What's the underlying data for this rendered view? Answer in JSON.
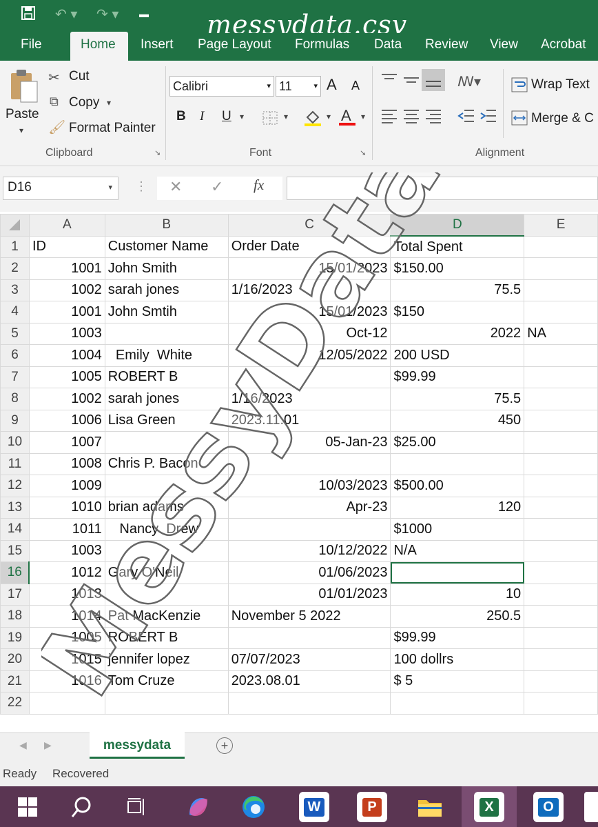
{
  "window": {
    "title": "messydata.csv"
  },
  "tabs": [
    "File",
    "Home",
    "Insert",
    "Page Layout",
    "Formulas",
    "Data",
    "Review",
    "View",
    "Acrobat"
  ],
  "ribbon": {
    "clipboard": {
      "paste": "Paste",
      "cut": "Cut",
      "copy": "Copy",
      "format_painter": "Format Painter",
      "label": "Clipboard"
    },
    "font": {
      "family": "Calibri",
      "size": "11",
      "label": "Font",
      "bold": "B",
      "italic": "I",
      "underline": "U",
      "grow": "A",
      "shrink": "A"
    },
    "alignment": {
      "wrap_text": "Wrap Text",
      "merge": "Merge & C",
      "label": "Alignment"
    }
  },
  "formula_bar": {
    "name_box": "D16",
    "fx": "fx",
    "value": ""
  },
  "grid": {
    "columns": [
      "A",
      "B",
      "C",
      "D",
      "E"
    ],
    "active_cell": "D16",
    "rows": [
      {
        "n": "1",
        "a": "ID",
        "b": "Customer Name",
        "c": "Order Date",
        "d": "Total Spent",
        "e": ""
      },
      {
        "n": "2",
        "a": "1001",
        "b": "John Smith",
        "c": "15/01/2023",
        "d": "$150.00",
        "e": ""
      },
      {
        "n": "3",
        "a": "1002",
        "b": "sarah jones",
        "c": "1/16/2023",
        "d": "75.5",
        "e": ""
      },
      {
        "n": "4",
        "a": "1001",
        "b": "John Smtih",
        "c": "15/01/2023",
        "d": "$150",
        "e": ""
      },
      {
        "n": "5",
        "a": "1003",
        "b": "",
        "c": "Oct-12",
        "d": "2022",
        "e": "NA"
      },
      {
        "n": "6",
        "a": "1004",
        "b": "  Emily  White",
        "c": "12/05/2022",
        "d": "200 USD",
        "e": ""
      },
      {
        "n": "7",
        "a": "1005",
        "b": "ROBERT B",
        "c": "",
        "d": "$99.99",
        "e": ""
      },
      {
        "n": "8",
        "a": "1002",
        "b": "sarah jones",
        "c": "1/16/2023",
        "d": "75.5",
        "e": ""
      },
      {
        "n": "9",
        "a": "1006",
        "b": "Lisa Green",
        "c": "2023.11.01",
        "d": "450",
        "e": ""
      },
      {
        "n": "10",
        "a": "1007",
        "b": "",
        "c": "05-Jan-23",
        "d": "$25.00",
        "e": ""
      },
      {
        "n": "11",
        "a": "1008",
        "b": "Chris P. Bacon",
        "c": "",
        "d": "",
        "e": ""
      },
      {
        "n": "12",
        "a": "1009",
        "b": "",
        "c": "10/03/2023",
        "d": "$500.00",
        "e": ""
      },
      {
        "n": "13",
        "a": "1010",
        "b": "brian adams",
        "c": "Apr-23",
        "d": "120",
        "e": ""
      },
      {
        "n": "14",
        "a": "1011",
        "b": "   Nancy  Drew",
        "c": "",
        "d": "$1000",
        "e": ""
      },
      {
        "n": "15",
        "a": "1003",
        "b": "",
        "c": "10/12/2022",
        "d": "N/A",
        "e": ""
      },
      {
        "n": "16",
        "a": "1012",
        "b": "Gary O'Neil",
        "c": "01/06/2023",
        "d": "",
        "e": ""
      },
      {
        "n": "17",
        "a": "1013",
        "b": "",
        "c": "01/01/2023",
        "d": "10",
        "e": ""
      },
      {
        "n": "18",
        "a": "1014",
        "b": "Pat MacKenzie",
        "c": "November 5 2022",
        "d": "250.5",
        "e": ""
      },
      {
        "n": "19",
        "a": "1005",
        "b": "ROBERT B",
        "c": "",
        "d": "$99.99",
        "e": ""
      },
      {
        "n": "20",
        "a": "1015",
        "b": "jennifer lopez",
        "c": "07/07/2023",
        "d": "100 dollrs",
        "e": ""
      },
      {
        "n": "21",
        "a": "1016",
        "b": "Tom Cruze",
        "c": "2023.08.01",
        "d": "$ 5",
        "e": ""
      },
      {
        "n": "22",
        "a": "",
        "b": "",
        "c": "",
        "d": "",
        "e": ""
      }
    ],
    "align": {
      "c_right_rows": [
        "2",
        "4",
        "5",
        "6",
        "10",
        "12",
        "13",
        "15",
        "16",
        "17"
      ],
      "d_right_rows": [
        "3",
        "5",
        "8",
        "9",
        "13",
        "17",
        "18"
      ]
    }
  },
  "sheet_tabs": {
    "active": "messydata",
    "add": "+"
  },
  "status": {
    "ready": "Ready",
    "recovered": "Recovered"
  },
  "watermark": {
    "text": "MessyData"
  },
  "taskbar": {
    "items": [
      "windows-start",
      "search",
      "task-view",
      "copilot",
      "edge",
      "word",
      "powerpoint",
      "file-explorer",
      "excel",
      "outlook"
    ]
  },
  "colors": {
    "excel_green": "#1f7244",
    "taskbar": "#5a3552"
  }
}
